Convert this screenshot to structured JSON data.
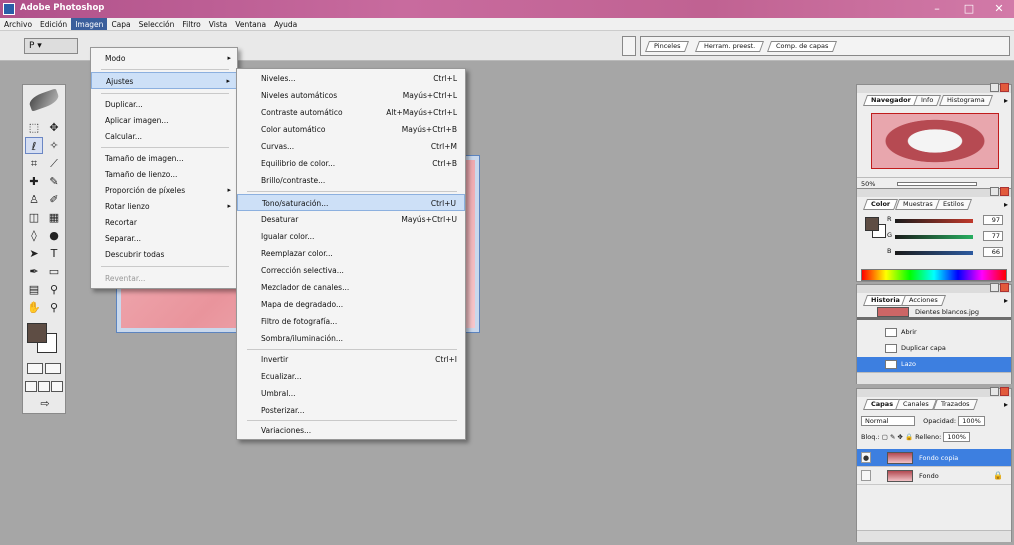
{
  "window": {
    "title": "Adobe Photoshop",
    "controls": {
      "minimize": "–",
      "maximize": "□",
      "close": "✕"
    }
  },
  "menubar": [
    "Archivo",
    "Edición",
    "Imagen",
    "Capa",
    "Selección",
    "Filtro",
    "Vista",
    "Ventana",
    "Ayuda"
  ],
  "options_bar": {
    "tool_preset": "P ▾",
    "palette_well_tabs": [
      "Pinceles",
      "Herram. preest.",
      "Comp. de capas"
    ]
  },
  "imagen_menu": {
    "items": [
      {
        "label": "Modo",
        "submenu": true
      },
      {
        "label": "Ajustes",
        "submenu": true,
        "highlighted": true
      },
      {
        "label": "Duplicar..."
      },
      {
        "label": "Aplicar imagen..."
      },
      {
        "label": "Calcular..."
      },
      {
        "label": "Tamaño de imagen..."
      },
      {
        "label": "Tamaño de lienzo..."
      },
      {
        "label": "Proporción de píxeles",
        "submenu": true
      },
      {
        "label": "Rotar lienzo",
        "submenu": true
      },
      {
        "label": "Recortar"
      },
      {
        "label": "Separar..."
      },
      {
        "label": "Descubrir todas"
      },
      {
        "label": "Reventar...",
        "disabled": true
      }
    ]
  },
  "ajustes_menu": {
    "items": [
      {
        "label": "Niveles...",
        "shortcut": "Ctrl+L"
      },
      {
        "label": "Niveles automáticos",
        "shortcut": "Mayús+Ctrl+L"
      },
      {
        "label": "Contraste automático",
        "shortcut": "Alt+Mayús+Ctrl+L"
      },
      {
        "label": "Color automático",
        "shortcut": "Mayús+Ctrl+B"
      },
      {
        "label": "Curvas...",
        "shortcut": "Ctrl+M"
      },
      {
        "label": "Equilibrio de color...",
        "shortcut": "Ctrl+B"
      },
      {
        "label": "Brillo/contraste...",
        "shortcut": ""
      },
      {
        "label": "Tono/saturación...",
        "shortcut": "Ctrl+U",
        "highlighted": true
      },
      {
        "label": "Desaturar",
        "shortcut": "Mayús+Ctrl+U"
      },
      {
        "label": "Igualar color...",
        "shortcut": ""
      },
      {
        "label": "Reemplazar color...",
        "shortcut": ""
      },
      {
        "label": "Corrección selectiva...",
        "shortcut": ""
      },
      {
        "label": "Mezclador de canales...",
        "shortcut": ""
      },
      {
        "label": "Mapa de degradado...",
        "shortcut": ""
      },
      {
        "label": "Filtro de fotografía...",
        "shortcut": ""
      },
      {
        "label": "Sombra/iluminación...",
        "shortcut": ""
      },
      {
        "label": "Invertir",
        "shortcut": "Ctrl+I"
      },
      {
        "label": "Ecualizar...",
        "shortcut": ""
      },
      {
        "label": "Umbral...",
        "shortcut": ""
      },
      {
        "label": "Posterizar...",
        "shortcut": ""
      },
      {
        "label": "Variaciones...",
        "shortcut": ""
      }
    ]
  },
  "navigator_palette": {
    "tabs": [
      "Navegador",
      "Info",
      "Histograma"
    ],
    "zoom": "50%"
  },
  "color_palette": {
    "tabs": [
      "Color",
      "Muestras",
      "Estilos"
    ],
    "channels": [
      {
        "name": "R",
        "value": "97",
        "color": "#c0392b"
      },
      {
        "name": "G",
        "value": "77",
        "color": "#27ae60"
      },
      {
        "name": "B",
        "value": "66",
        "color": "#2c5aa0"
      }
    ],
    "foreground": "#5e4d44",
    "background": "#ffffff"
  },
  "history_palette": {
    "tabs": [
      "Historia",
      "Acciones"
    ],
    "snapshot": "Dientes blancos.jpg",
    "items": [
      {
        "label": "Abrir",
        "selected": false
      },
      {
        "label": "Duplicar capa",
        "selected": false
      },
      {
        "label": "Lazo",
        "selected": true
      }
    ]
  },
  "layers_palette": {
    "tabs": [
      "Capas",
      "Canales",
      "Trazados"
    ],
    "blend_mode": "Normal",
    "opacity_label": "Opacidad:",
    "opacity": "100%",
    "lock_label": "Bloq.:",
    "fill_label": "Relleno:",
    "fill": "100%",
    "layers": [
      {
        "name": "Fondo copia",
        "selected": true
      },
      {
        "name": "Fondo",
        "selected": false
      }
    ]
  }
}
